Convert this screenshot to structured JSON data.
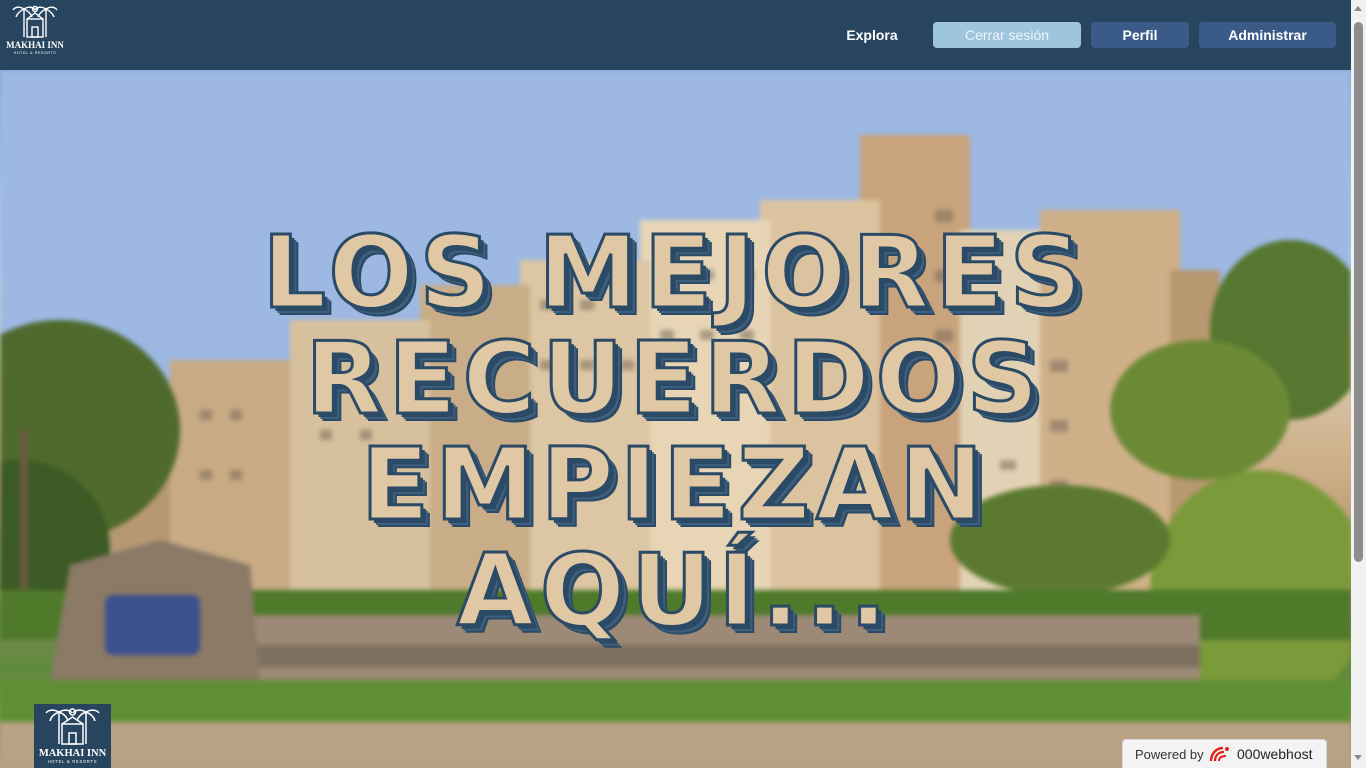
{
  "brand": {
    "name": "MAKHAI INN",
    "tagline": "HOTEL & RESORTS"
  },
  "nav": {
    "explore_label": "Explora",
    "logout_label": "Cerrar sesión",
    "profile_label": "Perfil",
    "admin_label": "Administrar"
  },
  "hero": {
    "headline": "LOS MEJORES RECUERDOS EMPIEZAN AQUÍ..."
  },
  "badge": {
    "powered_label": "Powered by",
    "host_name": "000webhost"
  },
  "colors": {
    "navbar": "#27455f",
    "button": "#3a5a88",
    "logout_button": "#9fc5de",
    "headline_fill": "#e1c8a5",
    "headline_outline": "#2b4a66"
  },
  "icons": {
    "logo": "palm-hotel-logo",
    "host": "000webhost-logo-icon"
  }
}
